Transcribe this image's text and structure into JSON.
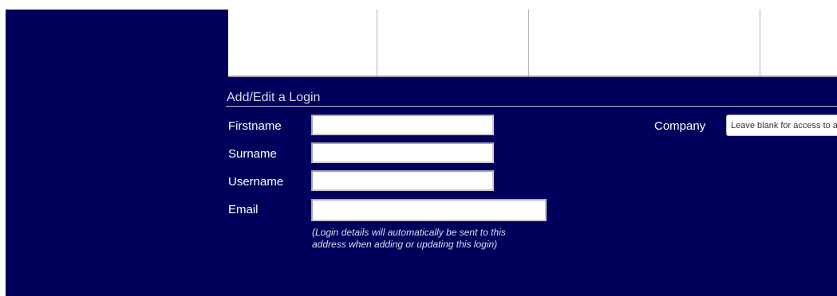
{
  "colors": {
    "panel_background": "#00005c",
    "top_area_background": "#ffffff",
    "label_text": "#ffffff",
    "help_text": "#dcdcee"
  },
  "form": {
    "title": "Add/Edit a Login",
    "firstname_label": "Firstname",
    "firstname_value": "",
    "surname_label": "Surname",
    "surname_value": "",
    "username_label": "Username",
    "username_value": "",
    "email_label": "Email",
    "email_value": "",
    "email_help_line1": "(Login details will automatically be sent to this",
    "email_help_line2": "address when adding or updating this login)",
    "company_label": "Company",
    "company_placeholder": "Leave blank for access to all",
    "company_value": ""
  }
}
